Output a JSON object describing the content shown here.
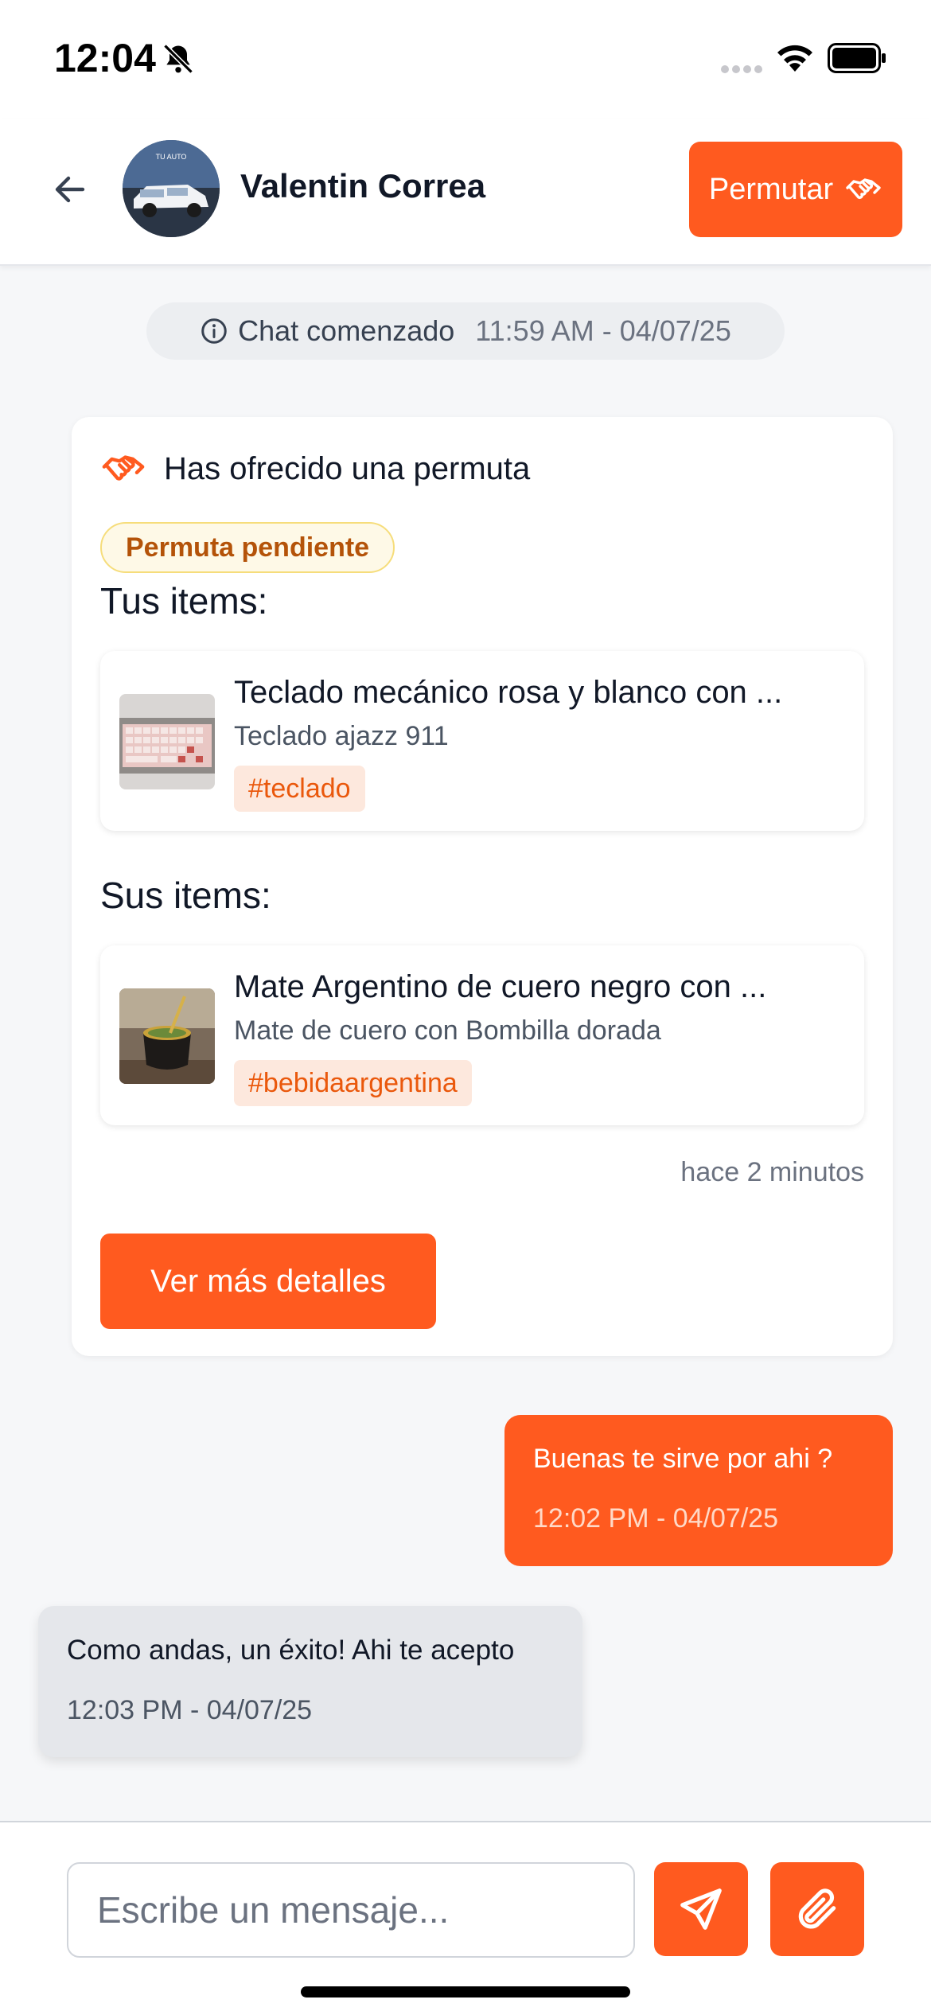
{
  "status_bar": {
    "time": "12:04",
    "icons": [
      "bell-slash-icon",
      "signal-dots-icon",
      "wifi-icon",
      "battery-icon"
    ]
  },
  "header": {
    "back_icon": "arrow-left-icon",
    "contact_name": "Valentin Correa",
    "avatar_label": "TU AUTO",
    "permutar_label": "Permutar",
    "permutar_icon": "handshake-icon"
  },
  "chat_started": {
    "icon": "info-icon",
    "label": "Chat comenzado",
    "time": "11:59 AM - 04/07/25"
  },
  "offer": {
    "icon": "handshake-icon",
    "title": "Has ofrecido una permuta",
    "status": "Permuta pendiente",
    "your_items_label": "Tus items:",
    "their_items_label": "Sus items:",
    "your_items": [
      {
        "title": "Teclado mecánico rosa y blanco con ...",
        "subtitle": "Teclado ajazz 911",
        "tag": "#teclado"
      }
    ],
    "their_items": [
      {
        "title": "Mate Argentino de cuero negro con ...",
        "subtitle": "Mate de cuero con Bombilla dorada",
        "tag": "#bebidaargentina"
      }
    ],
    "time_ago": "hace 2 minutos",
    "details_button": "Ver más detalles"
  },
  "messages": [
    {
      "direction": "outgoing",
      "text": "Buenas te sirve por ahi ?",
      "time": "12:02 PM - 04/07/25"
    },
    {
      "direction": "incoming",
      "text": "Como andas, un éxito! Ahi te acepto",
      "time": "12:03 PM - 04/07/25"
    }
  ],
  "composer": {
    "placeholder": "Escribe un mensaje...",
    "value": "",
    "send_icon": "send-icon",
    "attach_icon": "paperclip-icon"
  },
  "colors": {
    "accent": "#ff5a1f",
    "badge_bg": "#fef9e7",
    "badge_text": "#b45309",
    "tag_bg": "#fde8dd",
    "tag_text": "#ea580c",
    "background": "#f6f7f9"
  }
}
